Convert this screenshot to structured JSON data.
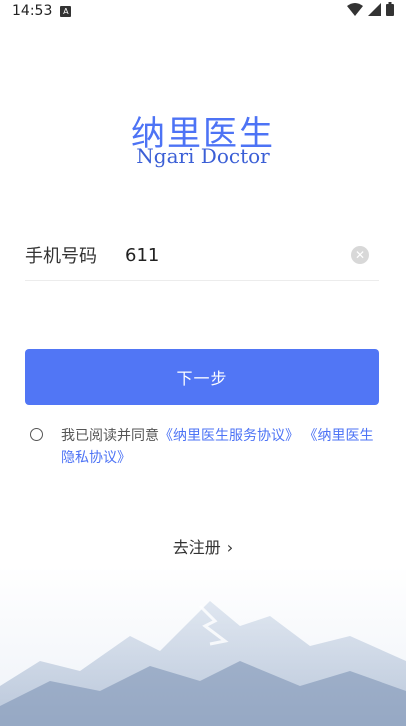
{
  "status_bar": {
    "time": "14:53",
    "sim_label": "A"
  },
  "logo": {
    "chinese": "纳里医生",
    "english": "Ngari Doctor"
  },
  "phone": {
    "label": "手机号码",
    "value": "611"
  },
  "next_button": "下一步",
  "agreement": {
    "prefix": "我已阅读并同意",
    "service_link": "《纳里医生服务协议》",
    "privacy_link": "《纳里医生隐私协议》"
  },
  "register": {
    "label": "去注册",
    "chevron": "›"
  },
  "colors": {
    "primary": "#5176f5",
    "link": "#4d73f5"
  },
  "icons": [
    "wifi-icon",
    "signal-icon",
    "battery-icon",
    "clear-icon",
    "chevron-right-icon"
  ]
}
